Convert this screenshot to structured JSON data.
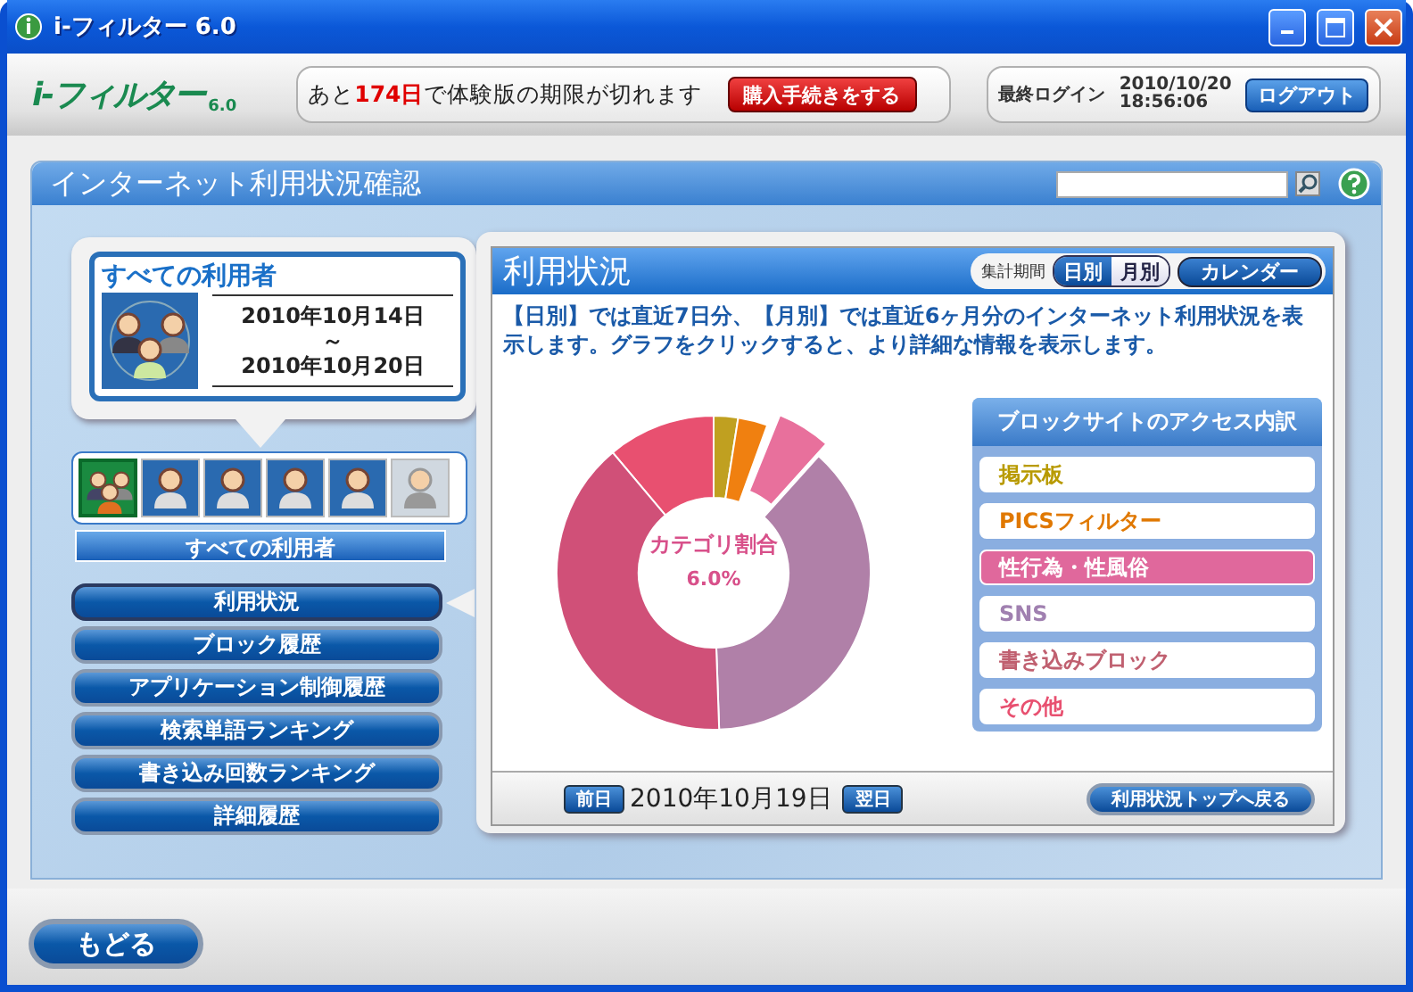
{
  "window": {
    "title": "i-フィルター 6.0"
  },
  "header": {
    "logo": {
      "text": "i-フィルター",
      "version": "6.0"
    },
    "trial": {
      "before": "あと",
      "days": "174日",
      "after": "で体験版の期限が切れます",
      "button": "購入手続きをする"
    },
    "login": {
      "label": "最終ログイン",
      "date": "2010/10/20",
      "time": "18:56:06",
      "button": "ログアウト"
    }
  },
  "page": {
    "title": "インターネット利用状況確認"
  },
  "user_card": {
    "title": "すべての利用者",
    "date_from": "2010年10月14日",
    "separator": "～",
    "date_to": "2010年10月20日"
  },
  "users": [
    {
      "kind": "group",
      "selected": true,
      "disabled": false
    },
    {
      "kind": "person",
      "selected": false,
      "disabled": false
    },
    {
      "kind": "person",
      "selected": false,
      "disabled": false
    },
    {
      "kind": "person",
      "selected": false,
      "disabled": false
    },
    {
      "kind": "person",
      "selected": false,
      "disabled": false
    },
    {
      "kind": "person",
      "selected": false,
      "disabled": true
    }
  ],
  "users_label": "すべての利用者",
  "nav": [
    {
      "label": "利用状況",
      "selected": true
    },
    {
      "label": "ブロック履歴",
      "selected": false
    },
    {
      "label": "アプリケーション制御履歴",
      "selected": false
    },
    {
      "label": "検索単語ランキング",
      "selected": false
    },
    {
      "label": "書き込み回数ランキング",
      "selected": false
    },
    {
      "label": "詳細履歴",
      "selected": false
    }
  ],
  "usage": {
    "title": "利用状況",
    "period_label": "集計期間",
    "period_tabs": [
      {
        "label": "日別",
        "selected": true
      },
      {
        "label": "月別",
        "selected": false
      }
    ],
    "calendar_button": "カレンダー",
    "description": "【日別】では直近7日分、【月別】では直近6ヶ月分のインターネット利用状況を表示します。グラフをクリックすると、より詳細な情報を表示します。",
    "chart": {
      "center_label": "カテゴリ割合",
      "center_value": "6.0%"
    },
    "legend": {
      "title": "ブロックサイトのアクセス内訳",
      "items": [
        {
          "label": "掲示板",
          "color": "#b89a00",
          "selected": false
        },
        {
          "label": "PICSフィルター",
          "color": "#e07800",
          "selected": false
        },
        {
          "label": "性行為・性風俗",
          "color": "#e0689c",
          "selected": true
        },
        {
          "label": "SNS",
          "color": "#a080b0",
          "selected": false
        },
        {
          "label": "書き込みブロック",
          "color": "#c06070",
          "selected": false
        },
        {
          "label": "その他",
          "color": "#e85070",
          "selected": false
        }
      ]
    },
    "footer": {
      "prev": "前日",
      "date": "2010年10月19日",
      "next": "翌日",
      "back_button": "利用状況トップへ戻る"
    }
  },
  "back_button": "もどる"
}
